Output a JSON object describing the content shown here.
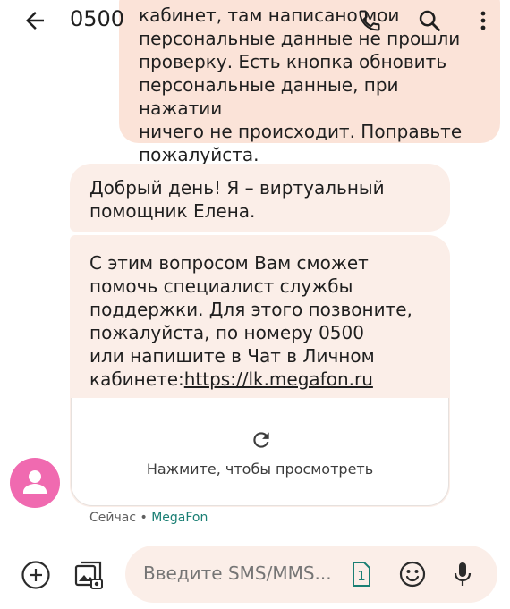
{
  "header": {
    "title": "0500"
  },
  "messages": {
    "outgoing_text": "кабинет, там написано мои\nперсональные данные не прошли\nпроверку. Есть кнопка обновить\nперсональные данные, при нажатии\nничего не происходит. Поправьте\nпожалуйста.",
    "incoming_1": "Добрый день! Я – виртуальный\nпомощник Елена.",
    "incoming_2_text": "С этим вопросом Вам сможет\nпомочь специалист службы\nподдержки. Для этого позвоните,\nпожалуйста, по номеру 0500\nили напишите в Чат в Личном\nкабинете:",
    "incoming_2_link": "https://lk.megafon.ru",
    "preview_label": "Нажмите, чтобы просмотреть",
    "timestamp": "Сейчас",
    "separator": " • ",
    "sender": "MegaFon"
  },
  "compose": {
    "placeholder": "Введите SMS/MMS...",
    "sim_slot": "1"
  },
  "icons": {
    "back": "arrow-back-icon",
    "call": "phone-icon",
    "search": "search-icon",
    "more": "more-vert-icon",
    "refresh": "refresh-icon",
    "add": "add-circle-icon",
    "gallery": "gallery-icon",
    "sim": "sim-card-icon",
    "emoji": "emoji-icon",
    "mic": "mic-icon"
  },
  "colors": {
    "outgoing_bubble": "#fbe3d8",
    "incoming_bubble": "#fbeee8",
    "avatar": "#f06ab0",
    "sender_accent": "#1a7f74"
  }
}
